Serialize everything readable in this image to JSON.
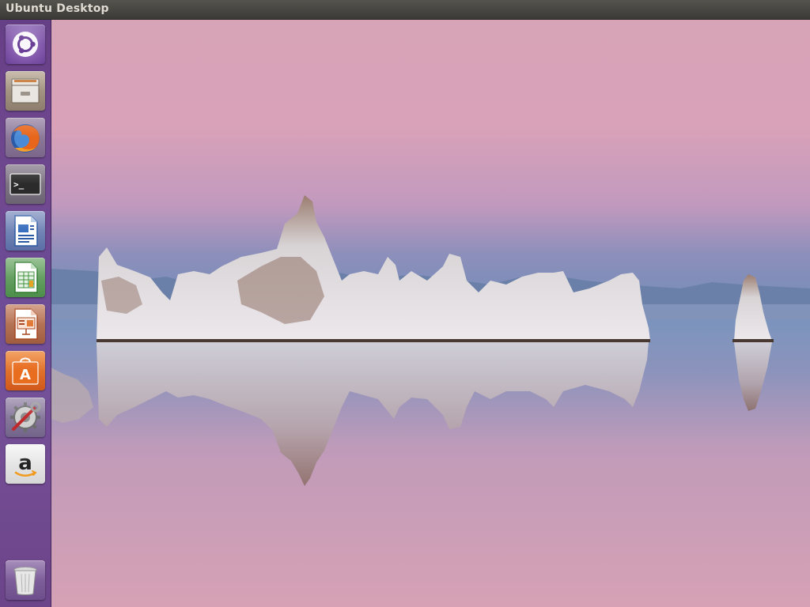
{
  "panel": {
    "title": "Ubuntu Desktop"
  },
  "launcher": {
    "items": [
      {
        "name": "dash-home",
        "icon": "ubuntu-logo-icon"
      },
      {
        "name": "files",
        "icon": "file-cabinet-icon"
      },
      {
        "name": "firefox",
        "icon": "firefox-icon"
      },
      {
        "name": "terminal",
        "icon": "terminal-icon",
        "glyph": ">_"
      },
      {
        "name": "libreoffice-writer",
        "icon": "document-icon"
      },
      {
        "name": "libreoffice-calc",
        "icon": "spreadsheet-icon"
      },
      {
        "name": "libreoffice-impress",
        "icon": "presentation-icon"
      },
      {
        "name": "software-center",
        "icon": "shopping-bag-icon",
        "glyph": "A"
      },
      {
        "name": "system-settings",
        "icon": "settings-icon"
      },
      {
        "name": "amazon",
        "icon": "amazon-icon",
        "glyph": "a"
      },
      {
        "name": "trash",
        "icon": "trash-icon"
      }
    ]
  },
  "colors": {
    "launcher": "#6a4590",
    "panel": "#3c3b37",
    "panel_text": "#dfdbd2"
  }
}
